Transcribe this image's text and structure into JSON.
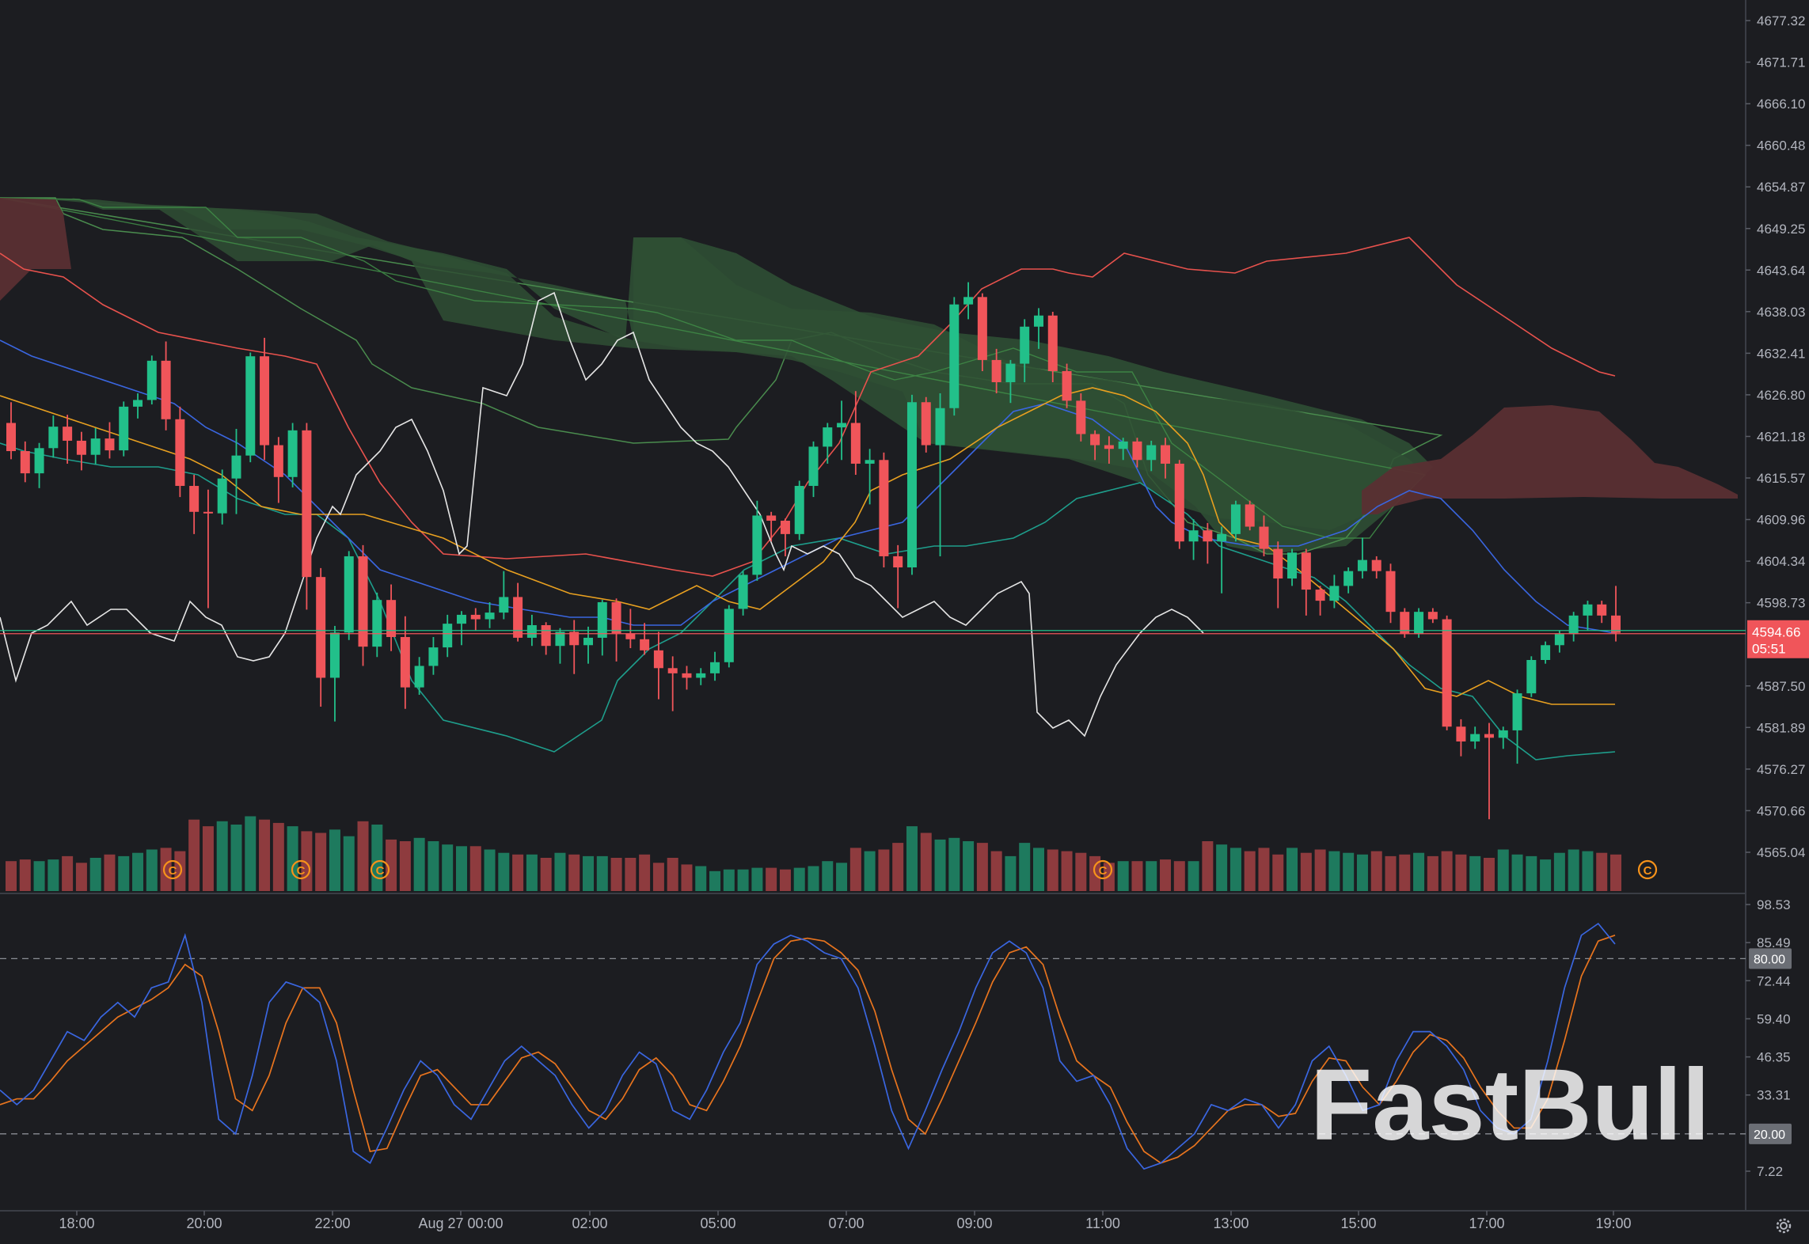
{
  "brand": {
    "logo_text": "FastBull"
  },
  "price_tag": {
    "price": "4594.66",
    "countdown": "05:51"
  },
  "stoch_tags": {
    "upper": "80.00",
    "lower": "20.00"
  },
  "colors": {
    "background": "#1c1d21",
    "up": "#22c08a",
    "down": "#f0555a",
    "grid": "#2a2d35",
    "axis_text": "#b2b5be",
    "price_tag": "#f0555a",
    "stoch_k": "#3a66e0",
    "stoch_d": "#e8741e",
    "marker": "#f7931a",
    "cloud_bull": "#2f4f34",
    "cloud_bear": "#5a2f33"
  },
  "chart_data": [
    {
      "type": "candlestick",
      "title": "",
      "y_axis_ticks": [
        "4677.32",
        "4671.71",
        "4666.10",
        "4660.48",
        "4654.87",
        "4649.25",
        "4643.64",
        "4638.03",
        "4632.41",
        "4626.80",
        "4621.18",
        "4615.57",
        "4609.96",
        "4604.34",
        "4598.73",
        "4587.50",
        "4581.89",
        "4576.27",
        "4570.66",
        "4565.04"
      ],
      "ylim": [
        4562.3,
        4679.6
      ],
      "x_axis_ticks": [
        "18:00",
        "20:00",
        "22:00",
        "Aug 27 00:00",
        "02:00",
        "05:00",
        "07:00",
        "09:00",
        "11:00",
        "13:00",
        "15:00",
        "17:00",
        "19:00"
      ],
      "last_price": 4594.66,
      "indicators": [
        "Ichimoku Cloud",
        "Bollinger Bands",
        "Moving averages",
        "Volume"
      ],
      "candles": [
        [
          4623.0,
          4625.8,
          4618.1,
          4619.2
        ],
        [
          4619.2,
          4620.5,
          4615.0,
          4616.2
        ],
        [
          4616.2,
          4620.3,
          4614.2,
          4619.6
        ],
        [
          4619.6,
          4624.0,
          4618.3,
          4622.5
        ],
        [
          4622.5,
          4624.1,
          4617.5,
          4620.6
        ],
        [
          4620.6,
          4621.8,
          4616.6,
          4618.7
        ],
        [
          4618.7,
          4622.3,
          4617.4,
          4620.9
        ],
        [
          4620.9,
          4623.1,
          4618.2,
          4619.3
        ],
        [
          4619.3,
          4625.9,
          4618.5,
          4625.2
        ],
        [
          4625.2,
          4627.0,
          4623.6,
          4626.1
        ],
        [
          4626.1,
          4632.1,
          4625.5,
          4631.4
        ],
        [
          4631.4,
          4634.0,
          4622.0,
          4623.5
        ],
        [
          4623.5,
          4625.2,
          4613.0,
          4614.5
        ],
        [
          4614.5,
          4616.0,
          4608.0,
          4611.0
        ],
        [
          4611.0,
          4614.0,
          4598.0,
          4610.8
        ],
        [
          4610.8,
          4616.7,
          4609.3,
          4615.5
        ],
        [
          4615.5,
          4622.2,
          4610.7,
          4618.6
        ],
        [
          4618.6,
          4632.5,
          4617.7,
          4632.0
        ],
        [
          4632.0,
          4634.5,
          4618.0,
          4620.0
        ],
        [
          4620.0,
          4621.1,
          4612.2,
          4615.7
        ],
        [
          4615.7,
          4623.0,
          4614.3,
          4622.0
        ],
        [
          4622.0,
          4623.0,
          4597.8,
          4602.2
        ],
        [
          4602.2,
          4603.4,
          4584.7,
          4588.6
        ],
        [
          4588.6,
          4595.6,
          4582.7,
          4594.7
        ],
        [
          4594.7,
          4605.7,
          4593.7,
          4605.0
        ],
        [
          4605.0,
          4606.5,
          4590.2,
          4592.8
        ],
        [
          4592.8,
          4600.1,
          4591.4,
          4599.1
        ],
        [
          4599.1,
          4601.2,
          4592.2,
          4594.1
        ],
        [
          4594.1,
          4596.9,
          4584.4,
          4587.3
        ],
        [
          4587.3,
          4591.4,
          4586.3,
          4590.2
        ],
        [
          4590.2,
          4594.1,
          4589.0,
          4592.7
        ],
        [
          4592.7,
          4597.1,
          4591.4,
          4595.9
        ],
        [
          4595.9,
          4597.6,
          4593.0,
          4597.1
        ],
        [
          4597.1,
          4598.0,
          4595.0,
          4596.5
        ],
        [
          4596.5,
          4598.8,
          4595.3,
          4597.4
        ],
        [
          4597.4,
          4603.0,
          4596.5,
          4599.5
        ],
        [
          4599.5,
          4601.4,
          4593.5,
          4594.0
        ],
        [
          4594.0,
          4597.1,
          4592.9,
          4595.7
        ],
        [
          4595.7,
          4596.1,
          4591.7,
          4592.9
        ],
        [
          4592.9,
          4595.3,
          4590.5,
          4594.8
        ],
        [
          4594.8,
          4596.4,
          4589.1,
          4593.0
        ],
        [
          4593.0,
          4595.5,
          4590.5,
          4594.0
        ],
        [
          4594.0,
          4599.1,
          4591.6,
          4598.8
        ],
        [
          4598.8,
          4599.3,
          4590.8,
          4594.6
        ],
        [
          4594.6,
          4597.9,
          4592.6,
          4593.8
        ],
        [
          4593.8,
          4596.0,
          4591.7,
          4592.3
        ],
        [
          4592.3,
          4594.8,
          4585.7,
          4589.9
        ],
        [
          4589.9,
          4591.5,
          4584.1,
          4589.2
        ],
        [
          4589.2,
          4590.2,
          4587.0,
          4588.6
        ],
        [
          4588.6,
          4589.9,
          4587.6,
          4589.2
        ],
        [
          4589.2,
          4592.1,
          4588.2,
          4590.7
        ],
        [
          4590.7,
          4598.4,
          4590.0,
          4597.9
        ],
        [
          4597.9,
          4603.0,
          4597.0,
          4602.5
        ],
        [
          4602.5,
          4612.5,
          4601.7,
          4610.5
        ],
        [
          4610.5,
          4611.0,
          4607.0,
          4609.8
        ],
        [
          4609.8,
          4610.1,
          4605.0,
          4608.0
        ],
        [
          4608.0,
          4615.2,
          4607.2,
          4614.5
        ],
        [
          4614.5,
          4620.5,
          4613.0,
          4619.8
        ],
        [
          4619.8,
          4623.0,
          4617.5,
          4622.4
        ],
        [
          4622.4,
          4626.0,
          4618.0,
          4623.0
        ],
        [
          4623.0,
          4627.3,
          4616.0,
          4617.5
        ],
        [
          4617.5,
          4619.5,
          4612.0,
          4618.0
        ],
        [
          4618.0,
          4619.0,
          4603.5,
          4605.0
        ],
        [
          4605.0,
          4606.5,
          4598.0,
          4603.5
        ],
        [
          4603.5,
          4626.8,
          4602.5,
          4625.8
        ],
        [
          4625.8,
          4626.5,
          4619.0,
          4620.0
        ],
        [
          4620.0,
          4627.0,
          4605.0,
          4625.0
        ],
        [
          4625.0,
          4640.0,
          4624.0,
          4639.0
        ],
        [
          4639.0,
          4642.0,
          4637.0,
          4640.0
        ],
        [
          4640.0,
          4640.5,
          4630.0,
          4631.5
        ],
        [
          4631.5,
          4633.0,
          4627.0,
          4628.5
        ],
        [
          4628.5,
          4631.5,
          4625.7,
          4631.0
        ],
        [
          4631.0,
          4637.0,
          4628.5,
          4636.0
        ],
        [
          4636.0,
          4638.5,
          4633.0,
          4637.5
        ],
        [
          4637.5,
          4638.0,
          4628.5,
          4630.0
        ],
        [
          4630.0,
          4631.0,
          4625.0,
          4626.0
        ],
        [
          4626.0,
          4627.0,
          4620.5,
          4621.5
        ],
        [
          4621.5,
          4622.0,
          4618.0,
          4620.0
        ],
        [
          4620.0,
          4621.2,
          4617.5,
          4619.5
        ],
        [
          4619.5,
          4621.0,
          4618.0,
          4620.5
        ],
        [
          4620.5,
          4621.0,
          4617.0,
          4618.0
        ],
        [
          4618.0,
          4620.6,
          4616.5,
          4620.0
        ],
        [
          4620.0,
          4621.0,
          4615.5,
          4617.5
        ],
        [
          4617.5,
          4618.0,
          4606.0,
          4607.0
        ],
        [
          4607.0,
          4610.0,
          4604.5,
          4608.5
        ],
        [
          4608.5,
          4609.5,
          4604.0,
          4607.0
        ],
        [
          4607.0,
          4609.0,
          4600.0,
          4608.0
        ],
        [
          4608.0,
          4612.5,
          4607.0,
          4612.0
        ],
        [
          4612.0,
          4612.5,
          4608.5,
          4609.0
        ],
        [
          4609.0,
          4610.5,
          4605.0,
          4606.0
        ],
        [
          4606.0,
          4607.0,
          4598.0,
          4602.0
        ],
        [
          4602.0,
          4606.0,
          4601.0,
          4605.5
        ],
        [
          4605.5,
          4606.0,
          4597.0,
          4600.5
        ],
        [
          4600.5,
          4601.0,
          4597.0,
          4599.0
        ],
        [
          4599.0,
          4602.5,
          4598.0,
          4601.0
        ],
        [
          4601.0,
          4603.5,
          4600.0,
          4603.0
        ],
        [
          4603.0,
          4607.5,
          4602.0,
          4604.5
        ],
        [
          4604.5,
          4605.0,
          4602.0,
          4603.0
        ],
        [
          4603.0,
          4604.0,
          4596.0,
          4597.5
        ],
        [
          4597.5,
          4598.0,
          4594.0,
          4594.5
        ],
        [
          4594.5,
          4598.0,
          4594.0,
          4597.5
        ],
        [
          4597.5,
          4598.0,
          4596.0,
          4596.5
        ],
        [
          4596.5,
          4597.0,
          4581.5,
          4582.0
        ],
        [
          4582.0,
          4583.0,
          4578.0,
          4580.0
        ],
        [
          4580.0,
          4582.0,
          4579.0,
          4581.0
        ],
        [
          4581.0,
          4582.5,
          4569.5,
          4580.5
        ],
        [
          4580.5,
          4582.0,
          4579.0,
          4581.5
        ],
        [
          4581.5,
          4587.0,
          4577.0,
          4586.5
        ],
        [
          4586.5,
          4591.5,
          4586.0,
          4591.0
        ],
        [
          4591.0,
          4593.5,
          4590.5,
          4593.0
        ],
        [
          4593.0,
          4595.0,
          4592.0,
          4594.5
        ],
        [
          4594.5,
          4597.5,
          4593.5,
          4597.0
        ],
        [
          4597.0,
          4599.0,
          4595.0,
          4598.5
        ],
        [
          4598.5,
          4599.0,
          4596.0,
          4597.0
        ],
        [
          4597.0,
          4601.0,
          4593.5,
          4594.66
        ]
      ],
      "volume": [
        "d",
        6,
        "u",
        6,
        "u",
        6,
        "d",
        6,
        "u",
        7,
        "d",
        7,
        "u",
        7,
        "u",
        8,
        "d",
        8,
        "u",
        8,
        "d",
        8,
        "u",
        8,
        "d",
        8,
        "u",
        8,
        "d",
        8,
        "u",
        8,
        "d",
        8,
        "u",
        8,
        "u",
        8,
        "d",
        8,
        "u",
        8,
        "d",
        8,
        "d",
        8,
        "u",
        8,
        "d",
        8,
        "u",
        8,
        "d",
        8,
        "d",
        8,
        "u",
        8,
        "u",
        8,
        "d",
        8,
        "u",
        8,
        "d",
        8,
        "u",
        8,
        "d",
        8,
        "u",
        8,
        "d",
        8,
        "u",
        8,
        "d",
        8,
        "u",
        8,
        "d",
        8,
        "u",
        8,
        "d",
        8,
        "u",
        8,
        "d",
        8,
        "u",
        8,
        "d",
        8,
        "u",
        8,
        "d",
        8,
        "u",
        8,
        "d",
        8,
        "u",
        8,
        "d",
        8,
        "u",
        8,
        "d",
        8,
        "u",
        8,
        "d",
        8,
        "u",
        8,
        "d",
        8,
        "u",
        8,
        "d",
        8,
        "u",
        8,
        "d",
        8,
        "u",
        8,
        "d",
        8,
        "u",
        8,
        "d",
        8,
        "u",
        8,
        "d",
        8,
        "u",
        8,
        "d",
        8
      ],
      "volume_relative": [
        0.36,
        0.38,
        0.36,
        0.38,
        0.42,
        0.34,
        0.4,
        0.44,
        0.42,
        0.46,
        0.5,
        0.52,
        0.48,
        0.86,
        0.78,
        0.84,
        0.8,
        0.9,
        0.86,
        0.82,
        0.78,
        0.72,
        0.7,
        0.74,
        0.66,
        0.84,
        0.8,
        0.62,
        0.6,
        0.64,
        0.6,
        0.56,
        0.54,
        0.54,
        0.5,
        0.46,
        0.44,
        0.44,
        0.4,
        0.46,
        0.44,
        0.42,
        0.42,
        0.4,
        0.4,
        0.44,
        0.34,
        0.4,
        0.32,
        0.3,
        0.24,
        0.26,
        0.26,
        0.28,
        0.28,
        0.26,
        0.28,
        0.3,
        0.36,
        0.34,
        0.52,
        0.48,
        0.5,
        0.58,
        0.78,
        0.7,
        0.62,
        0.64,
        0.6,
        0.58,
        0.48,
        0.42,
        0.58,
        0.52,
        0.5,
        0.48,
        0.46,
        0.42,
        0.34,
        0.36,
        0.36,
        0.36,
        0.38,
        0.36,
        0.36,
        0.6,
        0.56,
        0.52,
        0.48,
        0.52,
        0.44,
        0.52,
        0.46,
        0.5,
        0.48,
        0.46,
        0.44,
        0.48,
        0.42,
        0.44,
        0.46,
        0.42,
        0.48,
        0.44,
        0.42,
        0.4,
        0.5,
        0.44,
        0.42,
        0.38,
        0.46,
        0.5,
        0.48,
        0.46,
        0.44,
        0.42,
        0.44,
        0.4,
        0.4
      ]
    },
    {
      "type": "line",
      "title": "",
      "y_axis_ticks": [
        "98.53",
        "85.49",
        "72.44",
        "59.40",
        "46.35",
        "33.31",
        "20.00",
        "7.22"
      ],
      "ylim": [
        0,
        100
      ],
      "levels": [
        80,
        20
      ],
      "series_k": [
        35,
        30,
        35,
        45,
        55,
        52,
        60,
        65,
        60,
        70,
        72,
        88,
        65,
        25,
        20,
        40,
        65,
        72,
        70,
        65,
        45,
        14,
        10,
        22,
        35,
        45,
        40,
        30,
        25,
        35,
        45,
        50,
        45,
        40,
        30,
        22,
        28,
        40,
        48,
        44,
        28,
        25,
        35,
        48,
        58,
        78,
        85,
        88,
        86,
        82,
        80,
        70,
        50,
        28,
        15,
        28,
        42,
        55,
        70,
        82,
        86,
        82,
        70,
        45,
        38,
        40,
        30,
        15,
        8,
        10,
        15,
        20,
        30,
        28,
        32,
        30,
        22,
        30,
        45,
        50,
        40,
        28,
        30,
        45,
        55,
        55,
        50,
        42,
        28,
        22,
        20,
        25,
        45,
        70,
        88,
        92,
        85
      ],
      "series_d": [
        30,
        32,
        32,
        38,
        45,
        50,
        55,
        60,
        63,
        66,
        70,
        78,
        74,
        55,
        32,
        28,
        40,
        58,
        70,
        70,
        58,
        35,
        14,
        15,
        28,
        40,
        42,
        36,
        30,
        30,
        38,
        46,
        48,
        44,
        36,
        28,
        25,
        32,
        42,
        46,
        40,
        30,
        28,
        38,
        50,
        65,
        80,
        86,
        87,
        86,
        82,
        76,
        62,
        42,
        25,
        20,
        32,
        45,
        58,
        72,
        82,
        84,
        78,
        60,
        45,
        40,
        36,
        24,
        14,
        10,
        12,
        16,
        22,
        28,
        30,
        30,
        26,
        27,
        38,
        46,
        45,
        36,
        30,
        38,
        48,
        54,
        52,
        46,
        36,
        28,
        22,
        22,
        32,
        52,
        74,
        86,
        88
      ]
    }
  ],
  "markers": [
    "C",
    "C",
    "C",
    "C",
    "C"
  ],
  "icons": {
    "settings": "gear-icon"
  }
}
